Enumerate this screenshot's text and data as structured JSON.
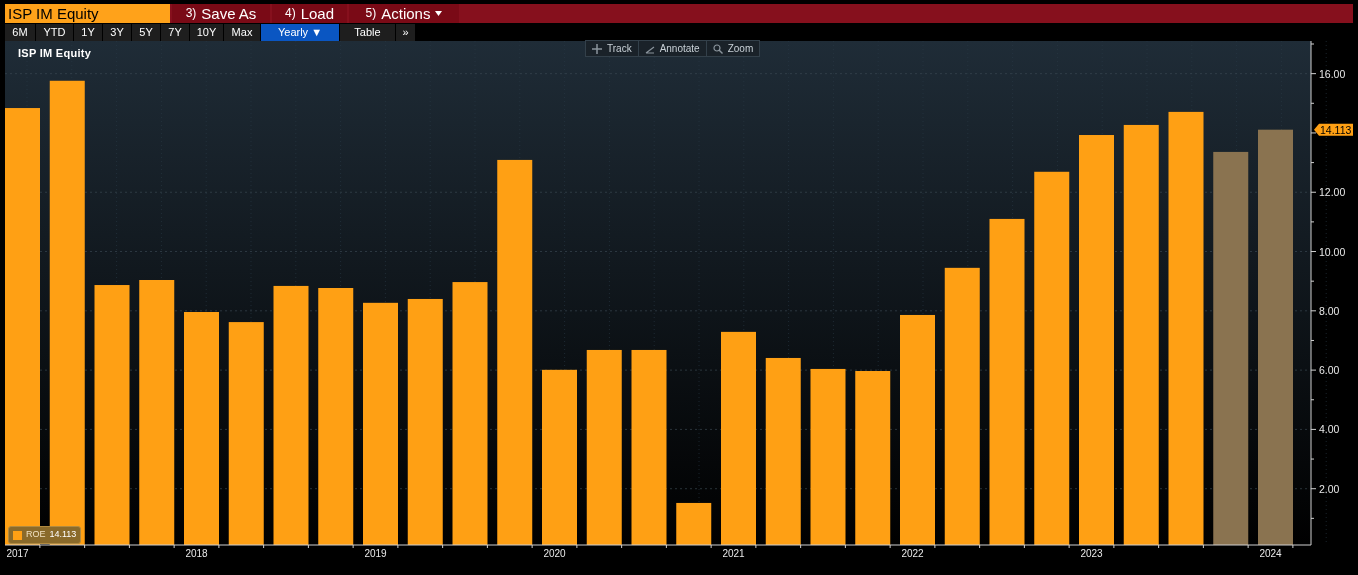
{
  "toolbar": {
    "security": "ISP IM Equity",
    "buttons": [
      {
        "number": "3)",
        "label": "Save As"
      },
      {
        "number": "4)",
        "label": "Load"
      },
      {
        "number": "5)",
        "label": "Actions",
        "dropdown": true
      }
    ]
  },
  "periods": [
    {
      "label": "6M",
      "selected": false
    },
    {
      "label": "YTD",
      "selected": false
    },
    {
      "label": "1Y",
      "selected": false
    },
    {
      "label": "3Y",
      "selected": false
    },
    {
      "label": "5Y",
      "selected": false
    },
    {
      "label": "7Y",
      "selected": false
    },
    {
      "label": "10Y",
      "selected": false
    },
    {
      "label": "Max",
      "selected": false
    },
    {
      "label": "Yearly ▼",
      "selected": true
    },
    {
      "label": "Table",
      "selected": false
    },
    {
      "label": "»",
      "selected": false
    }
  ],
  "chart": {
    "title": "ISP IM Equity",
    "tools": [
      {
        "kind": "track",
        "label": "Track"
      },
      {
        "kind": "annotate",
        "label": "Annotate"
      },
      {
        "kind": "zoom",
        "label": "Zoom"
      }
    ],
    "legend": {
      "value": "14.113"
    },
    "last_value_label": "14.113",
    "chart_data": {
      "type": "bar",
      "categories": [
        "2017",
        null,
        null,
        null,
        "2018",
        null,
        null,
        null,
        "2019",
        null,
        null,
        null,
        "2020",
        null,
        null,
        null,
        "2021",
        null,
        null,
        null,
        "2022",
        null,
        null,
        null,
        "2023",
        null,
        null,
        null,
        "2024"
      ],
      "series": [
        {
          "name": "ROE",
          "color": "#ffa014",
          "values": [
            14.84,
            15.76,
            8.87,
            9.04,
            7.96,
            7.62,
            8.84,
            8.77,
            8.27,
            8.4,
            8.97,
            13.09,
            6.01,
            6.68,
            6.68,
            1.52,
            7.29,
            6.41,
            6.04,
            5.97,
            7.86,
            9.45,
            11.1,
            12.69,
            13.93,
            14.27,
            14.71,
            null,
            null
          ]
        },
        {
          "color": "#8a7350",
          "values": [
            null,
            null,
            null,
            null,
            null,
            null,
            null,
            null,
            null,
            null,
            null,
            null,
            null,
            null,
            null,
            null,
            null,
            null,
            null,
            null,
            null,
            null,
            null,
            null,
            null,
            null,
            null,
            13.36,
            14.11
          ]
        }
      ],
      "ylim": [
        0,
        17
      ],
      "grid": true,
      "yticks": [
        {
          "value": 2,
          "label": "2.00"
        },
        {
          "value": 4,
          "label": "4.00"
        },
        {
          "value": 6,
          "label": "6.00"
        },
        {
          "value": 8,
          "label": "8.00"
        },
        {
          "value": 10,
          "label": "10.00"
        },
        {
          "value": 12,
          "label": "12.00"
        },
        {
          "value": 16,
          "label": "16.00"
        }
      ]
    }
  }
}
